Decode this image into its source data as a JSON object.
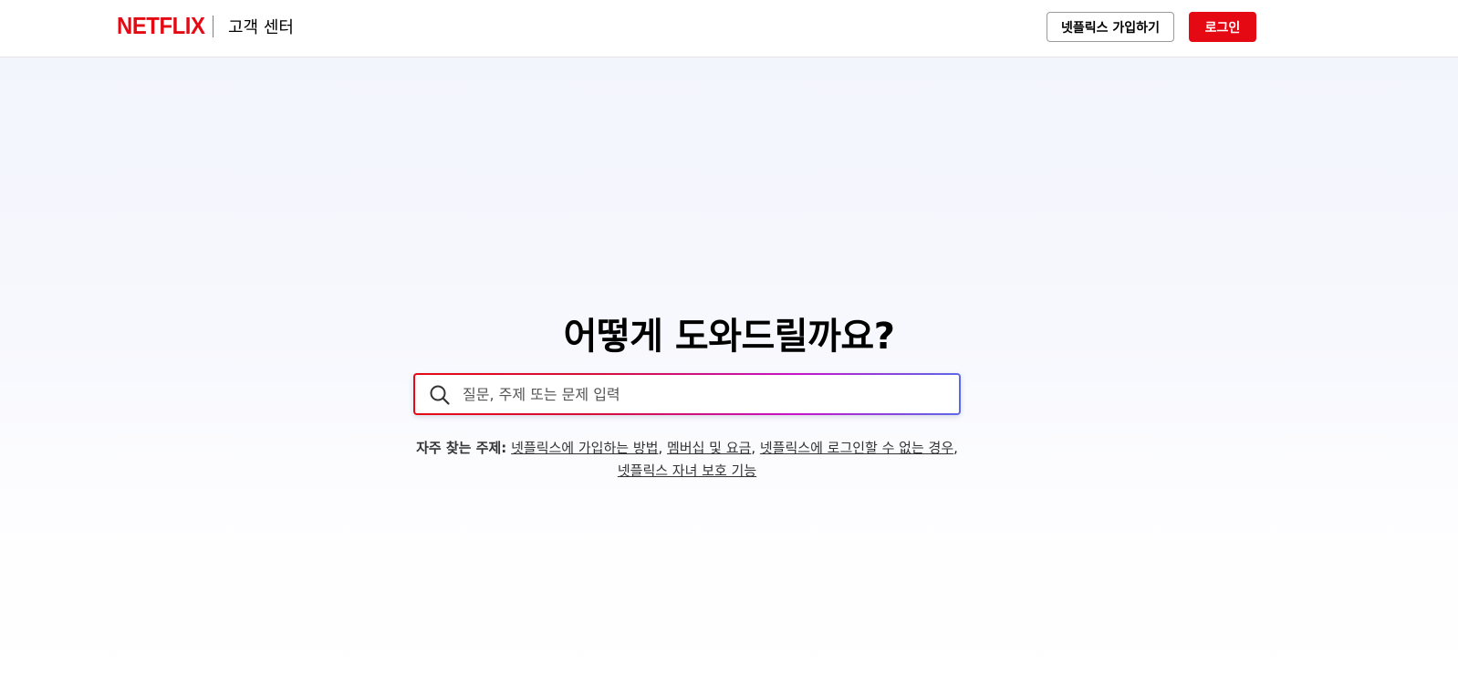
{
  "header": {
    "logo": "NETFLIX",
    "title": "고객 센터",
    "signup_label": "넷플릭스 가입하기",
    "login_label": "로그인"
  },
  "main": {
    "heading": "어떻게 도와드릴까요?",
    "search": {
      "placeholder": "질문, 주제 또는 문제 입력",
      "value": ""
    },
    "popular_topics": {
      "label": "자주 찾는 주제:",
      "links": [
        "넷플릭스에 가입하는 방법",
        "멤버십 및 요금",
        "넷플릭스에 로그인할 수 없는 경우",
        "넷플릭스 자녀 보호 기능"
      ]
    }
  },
  "colors": {
    "brand_red": "#e50914",
    "search_gradient_start": "#e50914",
    "search_gradient_end": "#5b6ae8"
  },
  "icons": {
    "search": "search-icon"
  }
}
